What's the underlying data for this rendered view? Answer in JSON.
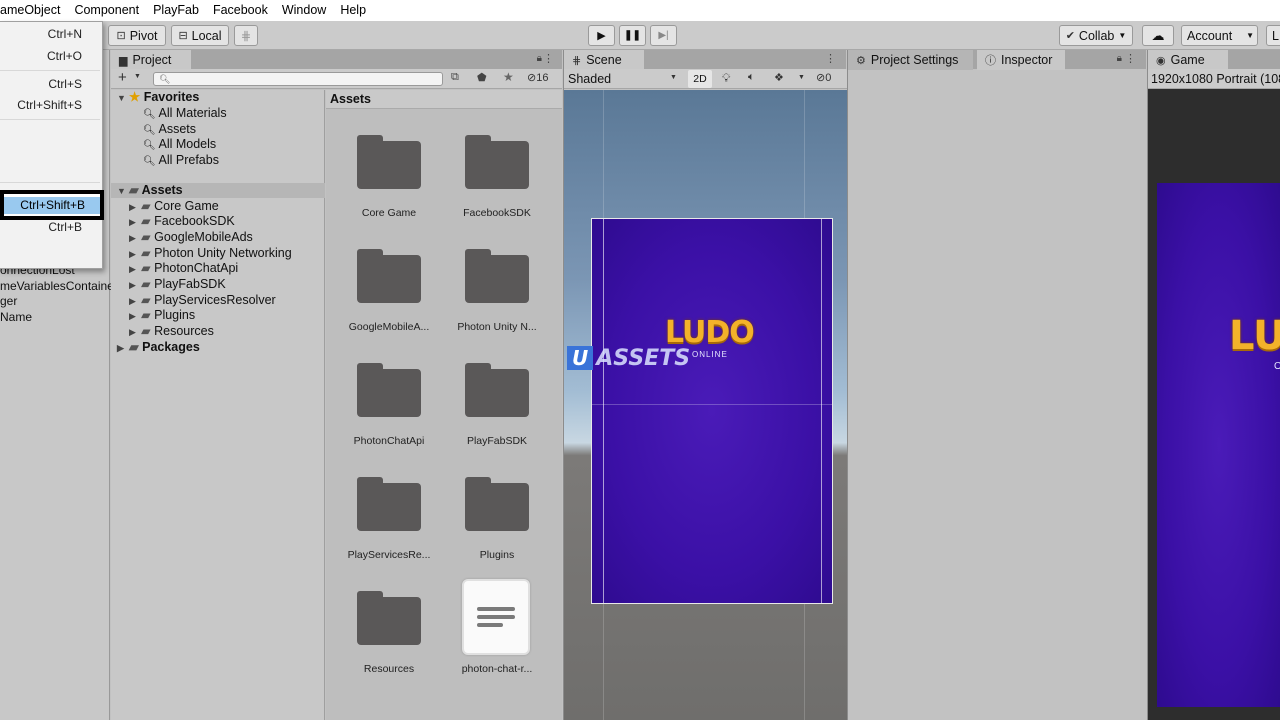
{
  "menubar": {
    "items": [
      "ameObject",
      "Component",
      "PlayFab",
      "Facebook",
      "Window",
      "Help"
    ]
  },
  "toolbar": {
    "pivot_label": "Pivot",
    "local_label": "Local",
    "collab_label": "Collab",
    "account_label": "Account",
    "layers_label": "L"
  },
  "file_menu": {
    "shortcuts": [
      "Ctrl+N",
      "Ctrl+O",
      "Ctrl+S",
      "Ctrl+Shift+S",
      "Ctrl+Shift+B",
      "Ctrl+B"
    ],
    "selected": "Ctrl+Shift+B"
  },
  "hierarchy": {
    "items": [
      "onnectionLost",
      "meVariablesContaine",
      "ger",
      "Name"
    ]
  },
  "project": {
    "tab_label": "Project",
    "search_placeholder": "",
    "hidden_count": "16",
    "favorites": {
      "label": "Favorites",
      "items": [
        "All Materials",
        "Assets",
        "All Models",
        "All Prefabs"
      ]
    },
    "assets_root": "Assets",
    "asset_folders": [
      "Core Game",
      "FacebookSDK",
      "GoogleMobileAds",
      "Photon Unity Networking",
      "PhotonChatApi",
      "PlayFabSDK",
      "PlayServicesResolver",
      "Plugins",
      "Resources"
    ],
    "packages_label": "Packages",
    "grid_header": "Assets",
    "grid_items": [
      "Core Game",
      "FacebookSDK",
      "GoogleMobileA...",
      "Photon Unity N...",
      "PhotonChatApi",
      "PlayFabSDK",
      "PlayServicesRe...",
      "Plugins",
      "Resources",
      "photon-chat-r..."
    ]
  },
  "scene": {
    "tab_label": "Scene",
    "shading_mode": "Shaded",
    "mode_2d": "2D",
    "gizmo_count": "0",
    "logo_text": "LUDO",
    "logo_sub": "ONLINE",
    "watermark_u": "U",
    "watermark_text": "ASSETS"
  },
  "inspector": {
    "settings_tab": "Project Settings",
    "inspector_tab": "Inspector"
  },
  "game": {
    "tab_label": "Game",
    "resolution": "1920x1080 Portrait (108",
    "logo_text": "LU",
    "logo_sub": "ON"
  }
}
